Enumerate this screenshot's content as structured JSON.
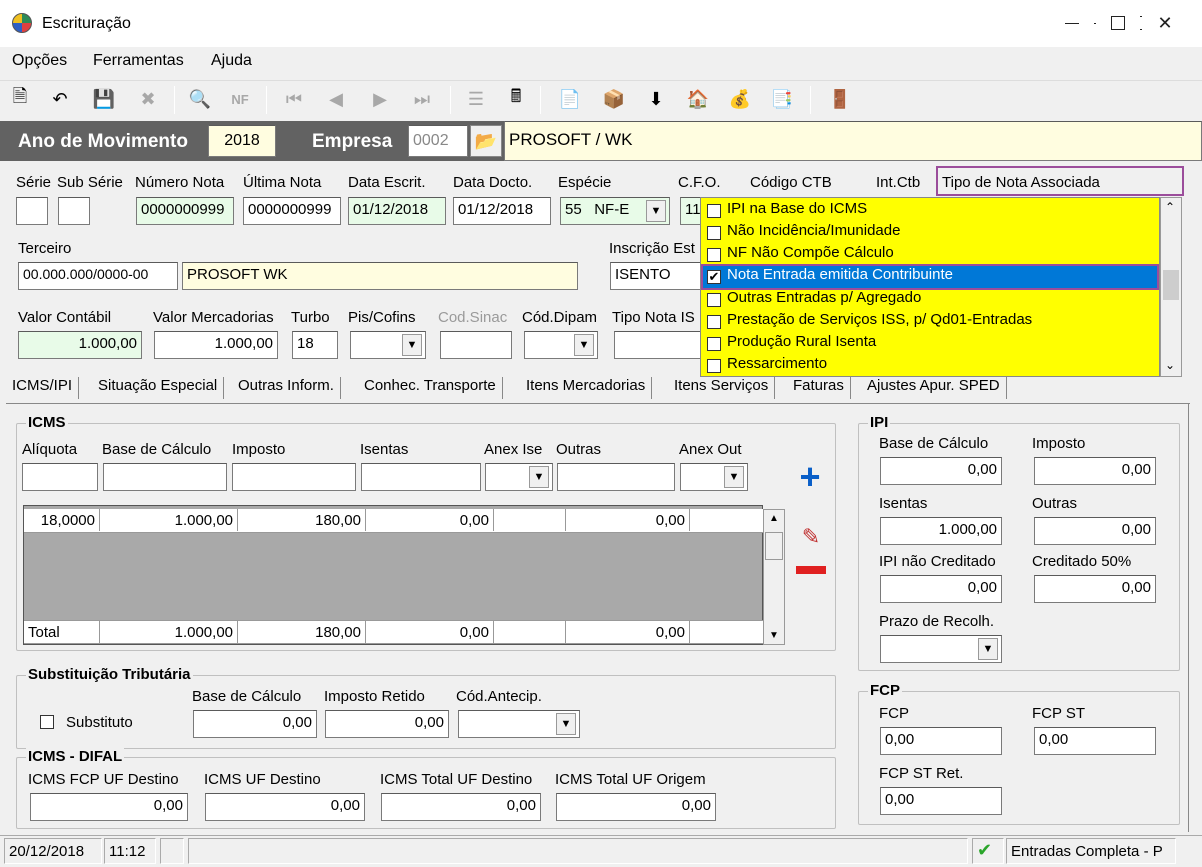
{
  "window": {
    "title": "Escrituração"
  },
  "menu": [
    "Opções",
    "Ferramentas",
    "Ajuda"
  ],
  "header": {
    "ano_label": "Ano de Movimento",
    "ano_value": "2018",
    "empresa_label": "Empresa",
    "empresa_code": "0002",
    "empresa_name": "PROSOFT / WK"
  },
  "nota": {
    "labels": {
      "serie": "Série",
      "sub_serie": "Sub Série",
      "numero_nota": "Número Nota",
      "ultima_nota": "Última Nota",
      "data_escrit": "Data Escrit.",
      "data_docto": "Data Docto.",
      "especie": "Espécie",
      "cfo": "C.F.O.",
      "codigo_ctb": "Código CTB",
      "int_ctb": "Int.Ctb",
      "tipo_nota_associada": "Tipo de Nota Associada",
      "terceiro": "Terceiro",
      "inscricao": "Inscrição Est",
      "valor_contabil": "Valor Contábil",
      "valor_mercadorias": "Valor Mercadorias",
      "turbo": "Turbo",
      "pis_cofins": "Pis/Cofins",
      "cod_sinac": "Cod.Sinac",
      "cod_dipam": "Cód.Dipam",
      "tipo_nota": "Tipo Nota IS"
    },
    "numero_nota": "0000000999",
    "ultima_nota": "0000000999",
    "data_escrit": "01/12/2018",
    "data_docto": "01/12/2018",
    "especie_code": "55",
    "especie_name": "NF-E",
    "cfo_partial": "11",
    "terceiro_doc": "00.000.000/0000-00",
    "terceiro_name": "PROSOFT WK",
    "inscricao": "ISENTO",
    "valor_contabil": "1.000,00",
    "valor_mercadorias": "1.000,00",
    "turbo": "18"
  },
  "tipo_list": {
    "items": [
      {
        "label": "IPI na Base do ICMS",
        "checked": false
      },
      {
        "label": "Não Incidência/Imunidade",
        "checked": false
      },
      {
        "label": "NF Não Compõe Cálculo",
        "checked": false
      },
      {
        "label": "Nota Entrada emitida Contribuinte",
        "checked": true
      },
      {
        "label": "Outras Entradas p/ Agregado",
        "checked": false
      },
      {
        "label": "Prestação de Serviços ISS, p/ Qd01-Entradas",
        "checked": false
      },
      {
        "label": "Produção Rural Isenta",
        "checked": false
      },
      {
        "label": "Ressarcimento",
        "checked": false
      }
    ]
  },
  "tabs": [
    "ICMS/IPI",
    "Situação Especial",
    "Outras Inform.",
    "Conhec. Transporte",
    "Itens Mercadorias",
    "Itens Serviços",
    "Faturas",
    "Ajustes Apur. SPED"
  ],
  "icms": {
    "title": "ICMS",
    "labels": {
      "aliquota": "Alíquota",
      "base": "Base de Cálculo",
      "imposto": "Imposto",
      "isentas": "Isentas",
      "anex_ise": "Anex Ise",
      "outras": "Outras",
      "anex_out": "Anex Out"
    },
    "row": [
      "18,0000",
      "1.000,00",
      "180,00",
      "0,00",
      "",
      "0,00"
    ],
    "total": [
      "Total",
      "1.000,00",
      "180,00",
      "0,00",
      "",
      "0,00"
    ]
  },
  "ipi": {
    "title": "IPI",
    "labels": {
      "base": "Base de Cálculo",
      "imposto": "Imposto",
      "isentas": "Isentas",
      "outras": "Outras",
      "nao_cred": "IPI não Creditado",
      "cred50": "Creditado 50%",
      "prazo": "Prazo de Recolh."
    },
    "base": "0,00",
    "imposto": "0,00",
    "isentas": "1.000,00",
    "outras": "0,00",
    "nao_cred": "0,00",
    "cred50": "0,00"
  },
  "st": {
    "title": "Substituição Tributária",
    "substituto": "Substituto",
    "labels": {
      "base": "Base de Cálculo",
      "imposto": "Imposto Retido",
      "antecip": "Cód.Antecip."
    },
    "base": "0,00",
    "imposto": "0,00"
  },
  "difal": {
    "title": "ICMS - DIFAL",
    "labels": {
      "fcp": "ICMS FCP UF Destino",
      "uf_dest": "ICMS UF Destino",
      "total_dest": "ICMS Total UF Destino",
      "total_orig": "ICMS Total UF Origem"
    },
    "values": [
      "0,00",
      "0,00",
      "0,00",
      "0,00"
    ]
  },
  "fcp": {
    "title": "FCP",
    "labels": {
      "fcp": "FCP",
      "fcp_st": "FCP ST",
      "fcp_st_ret": "FCP ST Ret."
    },
    "fcp": "0,00",
    "fcp_st": "0,00",
    "fcp_st_ret": "0,00"
  },
  "status": {
    "date": "20/12/2018",
    "time": "11:12",
    "mode": "Entradas Completa - P"
  },
  "colors": {
    "dark_bar": "#626262",
    "highlight": "#0078d7",
    "list_bg": "#ffff00",
    "outline": "#9b4d9b"
  }
}
